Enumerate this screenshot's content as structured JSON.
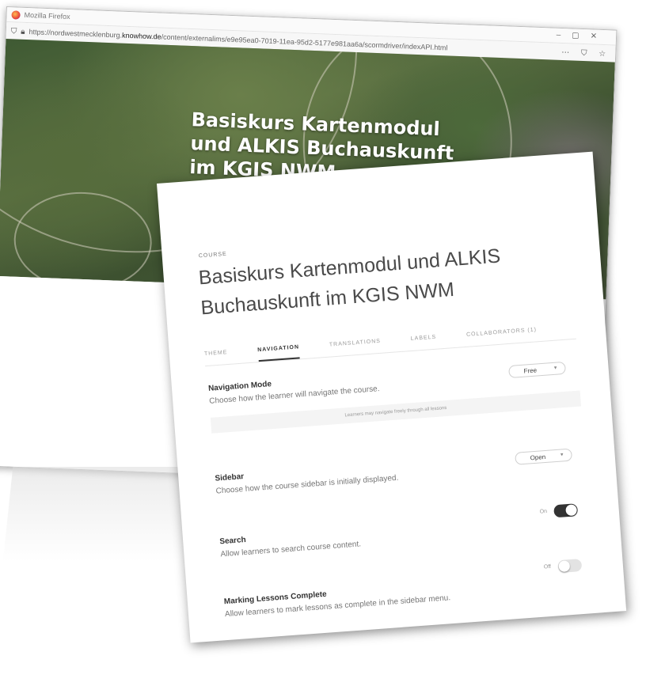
{
  "browser": {
    "window_title": "Mozilla Firefox",
    "url_prefix": "https://nordwestmecklenburg.",
    "url_domain": "knowhow.de",
    "url_path": "/content/externalims/e9e95ea0-7019-11ea-95d2-5177e981aa6a/scormdriver/indexAPI.html",
    "hero_title": "Basiskurs Kartenmodul und ALKIS Buchauskunft im KGIS NWM"
  },
  "panel": {
    "course_label": "COURSE",
    "course_title": "Basiskurs Kartenmodul und ALKIS Buchauskunft im KGIS NWM",
    "tabs": [
      {
        "label": "THEME"
      },
      {
        "label": "NAVIGATION"
      },
      {
        "label": "TRANSLATIONS"
      },
      {
        "label": "LABELS"
      },
      {
        "label": "COLLABORATORS (1)"
      }
    ],
    "active_tab": "NAVIGATION",
    "settings": {
      "navigation_mode": {
        "title": "Navigation Mode",
        "description": "Choose how the learner will navigate the course.",
        "value": "Free",
        "hint": "Learners may navigate freely through all lessons"
      },
      "sidebar": {
        "title": "Sidebar",
        "description": "Choose how the course sidebar is initially displayed.",
        "value": "Open"
      },
      "search": {
        "title": "Search",
        "description": "Allow learners to search course content.",
        "state_label": "On",
        "enabled": true
      },
      "marking_complete": {
        "title": "Marking Lessons Complete",
        "description": "Allow learners to mark lessons as complete in the sidebar menu.",
        "state_label": "Off",
        "enabled": false
      }
    }
  },
  "icons": {
    "browser_logo": "firefox-icon",
    "select_arrow": "chevron-down-icon"
  },
  "colors": {
    "toggle_on": "#333333",
    "toggle_off": "#e3e3e3",
    "hero_text": "#ffffff"
  }
}
